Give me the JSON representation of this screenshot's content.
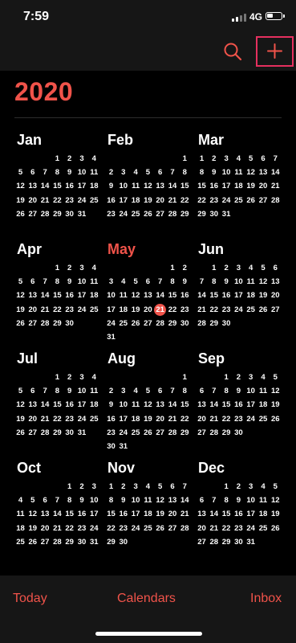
{
  "status_bar": {
    "time": "7:59",
    "network": "4G",
    "battery_level": 0.35,
    "signal_bars_active": 2
  },
  "toolbar": {
    "search_icon": "search-icon",
    "add_icon": "plus-icon",
    "accent_color": "#f0534a",
    "highlight_color": "#e5305f"
  },
  "year": "2020",
  "weekday_count": 7,
  "today": {
    "month_index": 4,
    "day": 21
  },
  "months": [
    {
      "name": "Jan",
      "first_weekday": 3,
      "days": 31
    },
    {
      "name": "Feb",
      "first_weekday": 6,
      "days": 29
    },
    {
      "name": "Mar",
      "first_weekday": 0,
      "days": 31
    },
    {
      "name": "Apr",
      "first_weekday": 3,
      "days": 30
    },
    {
      "name": "May",
      "first_weekday": 5,
      "days": 31
    },
    {
      "name": "Jun",
      "first_weekday": 1,
      "days": 30
    },
    {
      "name": "Jul",
      "first_weekday": 3,
      "days": 31
    },
    {
      "name": "Aug",
      "first_weekday": 6,
      "days": 31
    },
    {
      "name": "Sep",
      "first_weekday": 2,
      "days": 30
    },
    {
      "name": "Oct",
      "first_weekday": 4,
      "days": 31
    },
    {
      "name": "Nov",
      "first_weekday": 0,
      "days": 30
    },
    {
      "name": "Dec",
      "first_weekday": 2,
      "days": 31
    }
  ],
  "tab_bar": {
    "today": "Today",
    "calendars": "Calendars",
    "inbox": "Inbox"
  }
}
